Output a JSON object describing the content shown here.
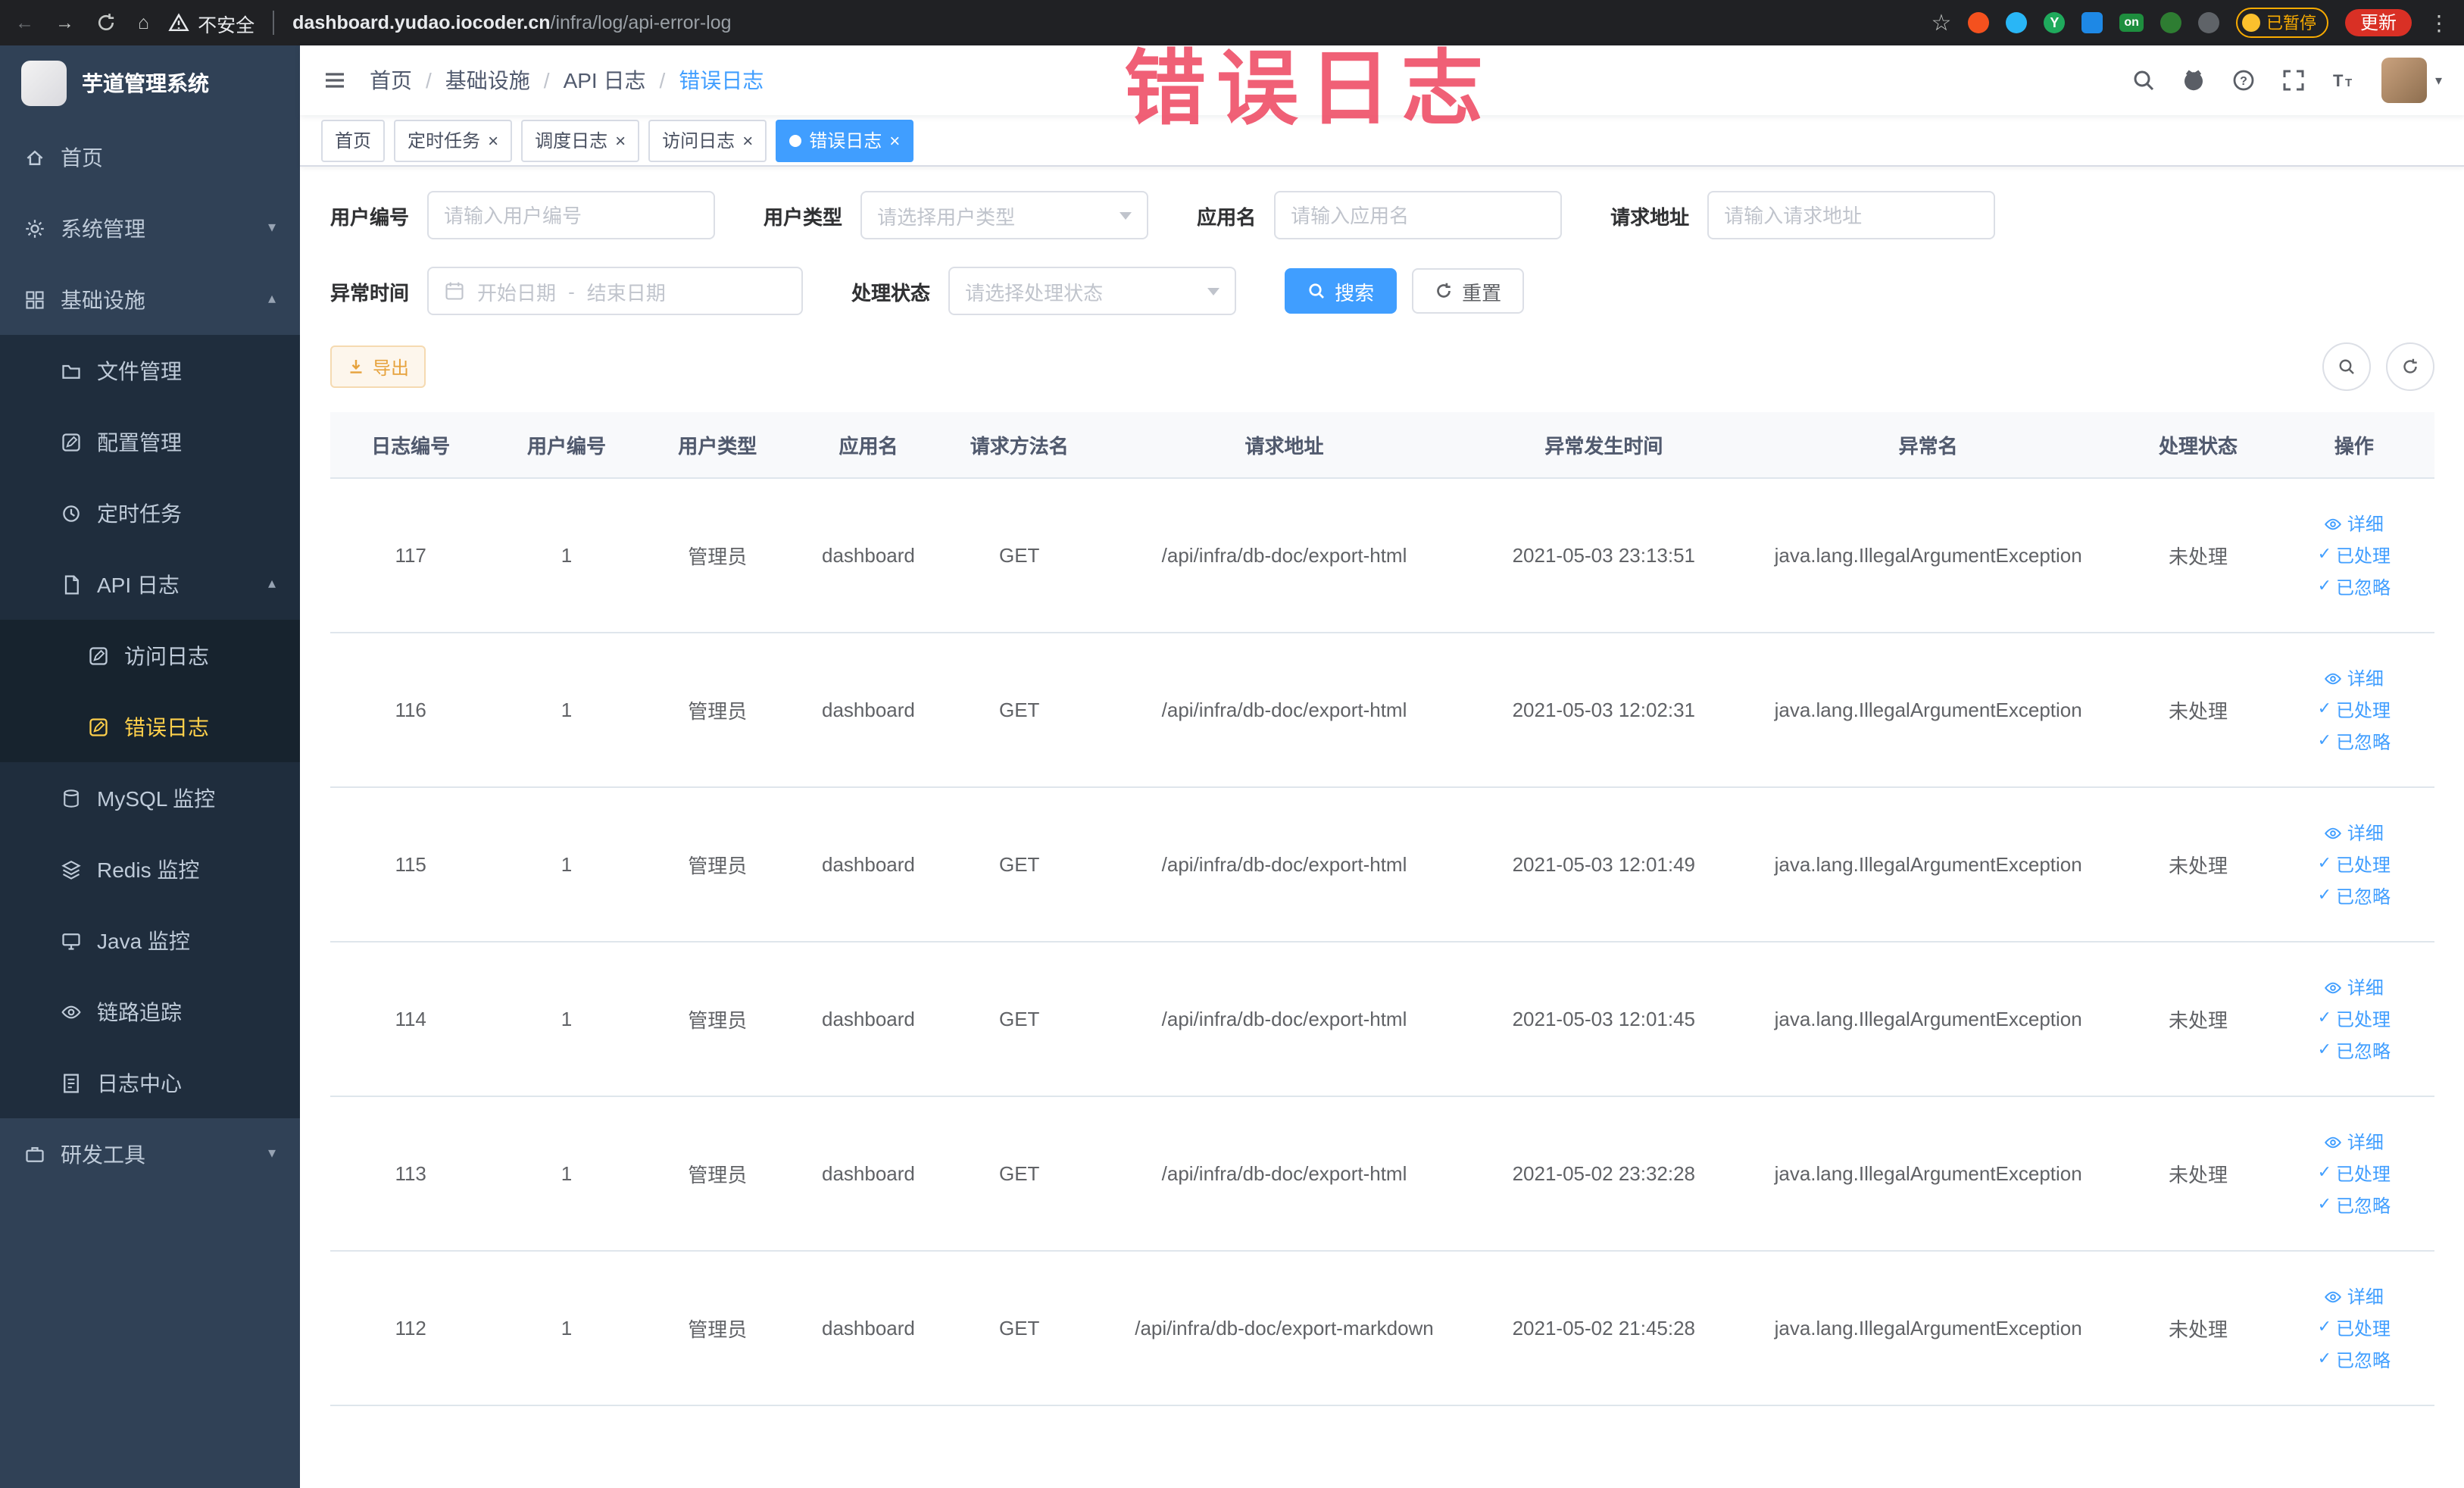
{
  "theme": {
    "primary": "#409EFF",
    "sidebar_bg": "#304156",
    "sidebar_sub_bg": "#1f2d3d",
    "active_menu_text": "#ffd04b",
    "warning": "#e6a23c"
  },
  "browser": {
    "security_label": "不安全",
    "url_host": "dashboard.yudao.iocoder.cn",
    "url_path": "/infra/log/api-error-log",
    "paused_badge": "已暂停",
    "update_button": "更新"
  },
  "annotation": {
    "text": "错误日志"
  },
  "sidebar": {
    "logo_title": "芋道管理系统",
    "menu": {
      "home": "首页",
      "system": "系统管理",
      "infra": "基础设施",
      "file": "文件管理",
      "config": "配置管理",
      "job": "定时任务",
      "api_log": "API 日志",
      "access_log": "访问日志",
      "error_log": "错误日志",
      "mysql": "MySQL 监控",
      "redis": "Redis 监控",
      "java": "Java 监控",
      "trace": "链路追踪",
      "log_center": "日志中心",
      "dev_tools": "研发工具"
    }
  },
  "header": {
    "breadcrumb": [
      "首页",
      "基础设施",
      "API 日志",
      "错误日志"
    ],
    "separator": "/"
  },
  "tabs": [
    {
      "label": "首页",
      "closable": false,
      "active": false
    },
    {
      "label": "定时任务",
      "closable": true,
      "active": false
    },
    {
      "label": "调度日志",
      "closable": true,
      "active": false
    },
    {
      "label": "访问日志",
      "closable": true,
      "active": false
    },
    {
      "label": "错误日志",
      "closable": true,
      "active": true
    }
  ],
  "filters": {
    "user_id": {
      "label": "用户编号",
      "placeholder": "请输入用户编号",
      "value": ""
    },
    "user_type": {
      "label": "用户类型",
      "placeholder": "请选择用户类型"
    },
    "app_name": {
      "label": "应用名",
      "placeholder": "请输入应用名",
      "value": ""
    },
    "request_url": {
      "label": "请求地址",
      "placeholder": "请输入请求地址",
      "value": ""
    },
    "exception_time": {
      "label": "异常时间",
      "start_placeholder": "开始日期",
      "separator": "-",
      "end_placeholder": "结束日期"
    },
    "process_status": {
      "label": "处理状态",
      "placeholder": "请选择处理状态"
    },
    "search_button": "搜索",
    "reset_button": "重置"
  },
  "toolbar": {
    "export_label": "导出"
  },
  "table": {
    "columns": [
      "日志编号",
      "用户编号",
      "用户类型",
      "应用名",
      "请求方法名",
      "请求地址",
      "异常发生时间",
      "异常名",
      "处理状态",
      "操作"
    ],
    "actions": {
      "detail": "详细",
      "processed": "已处理",
      "ignored": "已忽略"
    },
    "rows": [
      {
        "id": "117",
        "user_id": "1",
        "user_type": "管理员",
        "app_name": "dashboard",
        "method": "GET",
        "url": "/api/infra/db-doc/export-html",
        "time": "2021-05-03 23:13:51",
        "exception": "java.lang.IllegalArgumentException",
        "status": "未处理"
      },
      {
        "id": "116",
        "user_id": "1",
        "user_type": "管理员",
        "app_name": "dashboard",
        "method": "GET",
        "url": "/api/infra/db-doc/export-html",
        "time": "2021-05-03 12:02:31",
        "exception": "java.lang.IllegalArgumentException",
        "status": "未处理"
      },
      {
        "id": "115",
        "user_id": "1",
        "user_type": "管理员",
        "app_name": "dashboard",
        "method": "GET",
        "url": "/api/infra/db-doc/export-html",
        "time": "2021-05-03 12:01:49",
        "exception": "java.lang.IllegalArgumentException",
        "status": "未处理"
      },
      {
        "id": "114",
        "user_id": "1",
        "user_type": "管理员",
        "app_name": "dashboard",
        "method": "GET",
        "url": "/api/infra/db-doc/export-html",
        "time": "2021-05-03 12:01:45",
        "exception": "java.lang.IllegalArgumentException",
        "status": "未处理"
      },
      {
        "id": "113",
        "user_id": "1",
        "user_type": "管理员",
        "app_name": "dashboard",
        "method": "GET",
        "url": "/api/infra/db-doc/export-html",
        "time": "2021-05-02 23:32:28",
        "exception": "java.lang.IllegalArgumentException",
        "status": "未处理"
      },
      {
        "id": "112",
        "user_id": "1",
        "user_type": "管理员",
        "app_name": "dashboard",
        "method": "GET",
        "url": "/api/infra/db-doc/export-markdown",
        "time": "2021-05-02 21:45:28",
        "exception": "java.lang.IllegalArgumentException",
        "status": "未处理"
      }
    ]
  }
}
